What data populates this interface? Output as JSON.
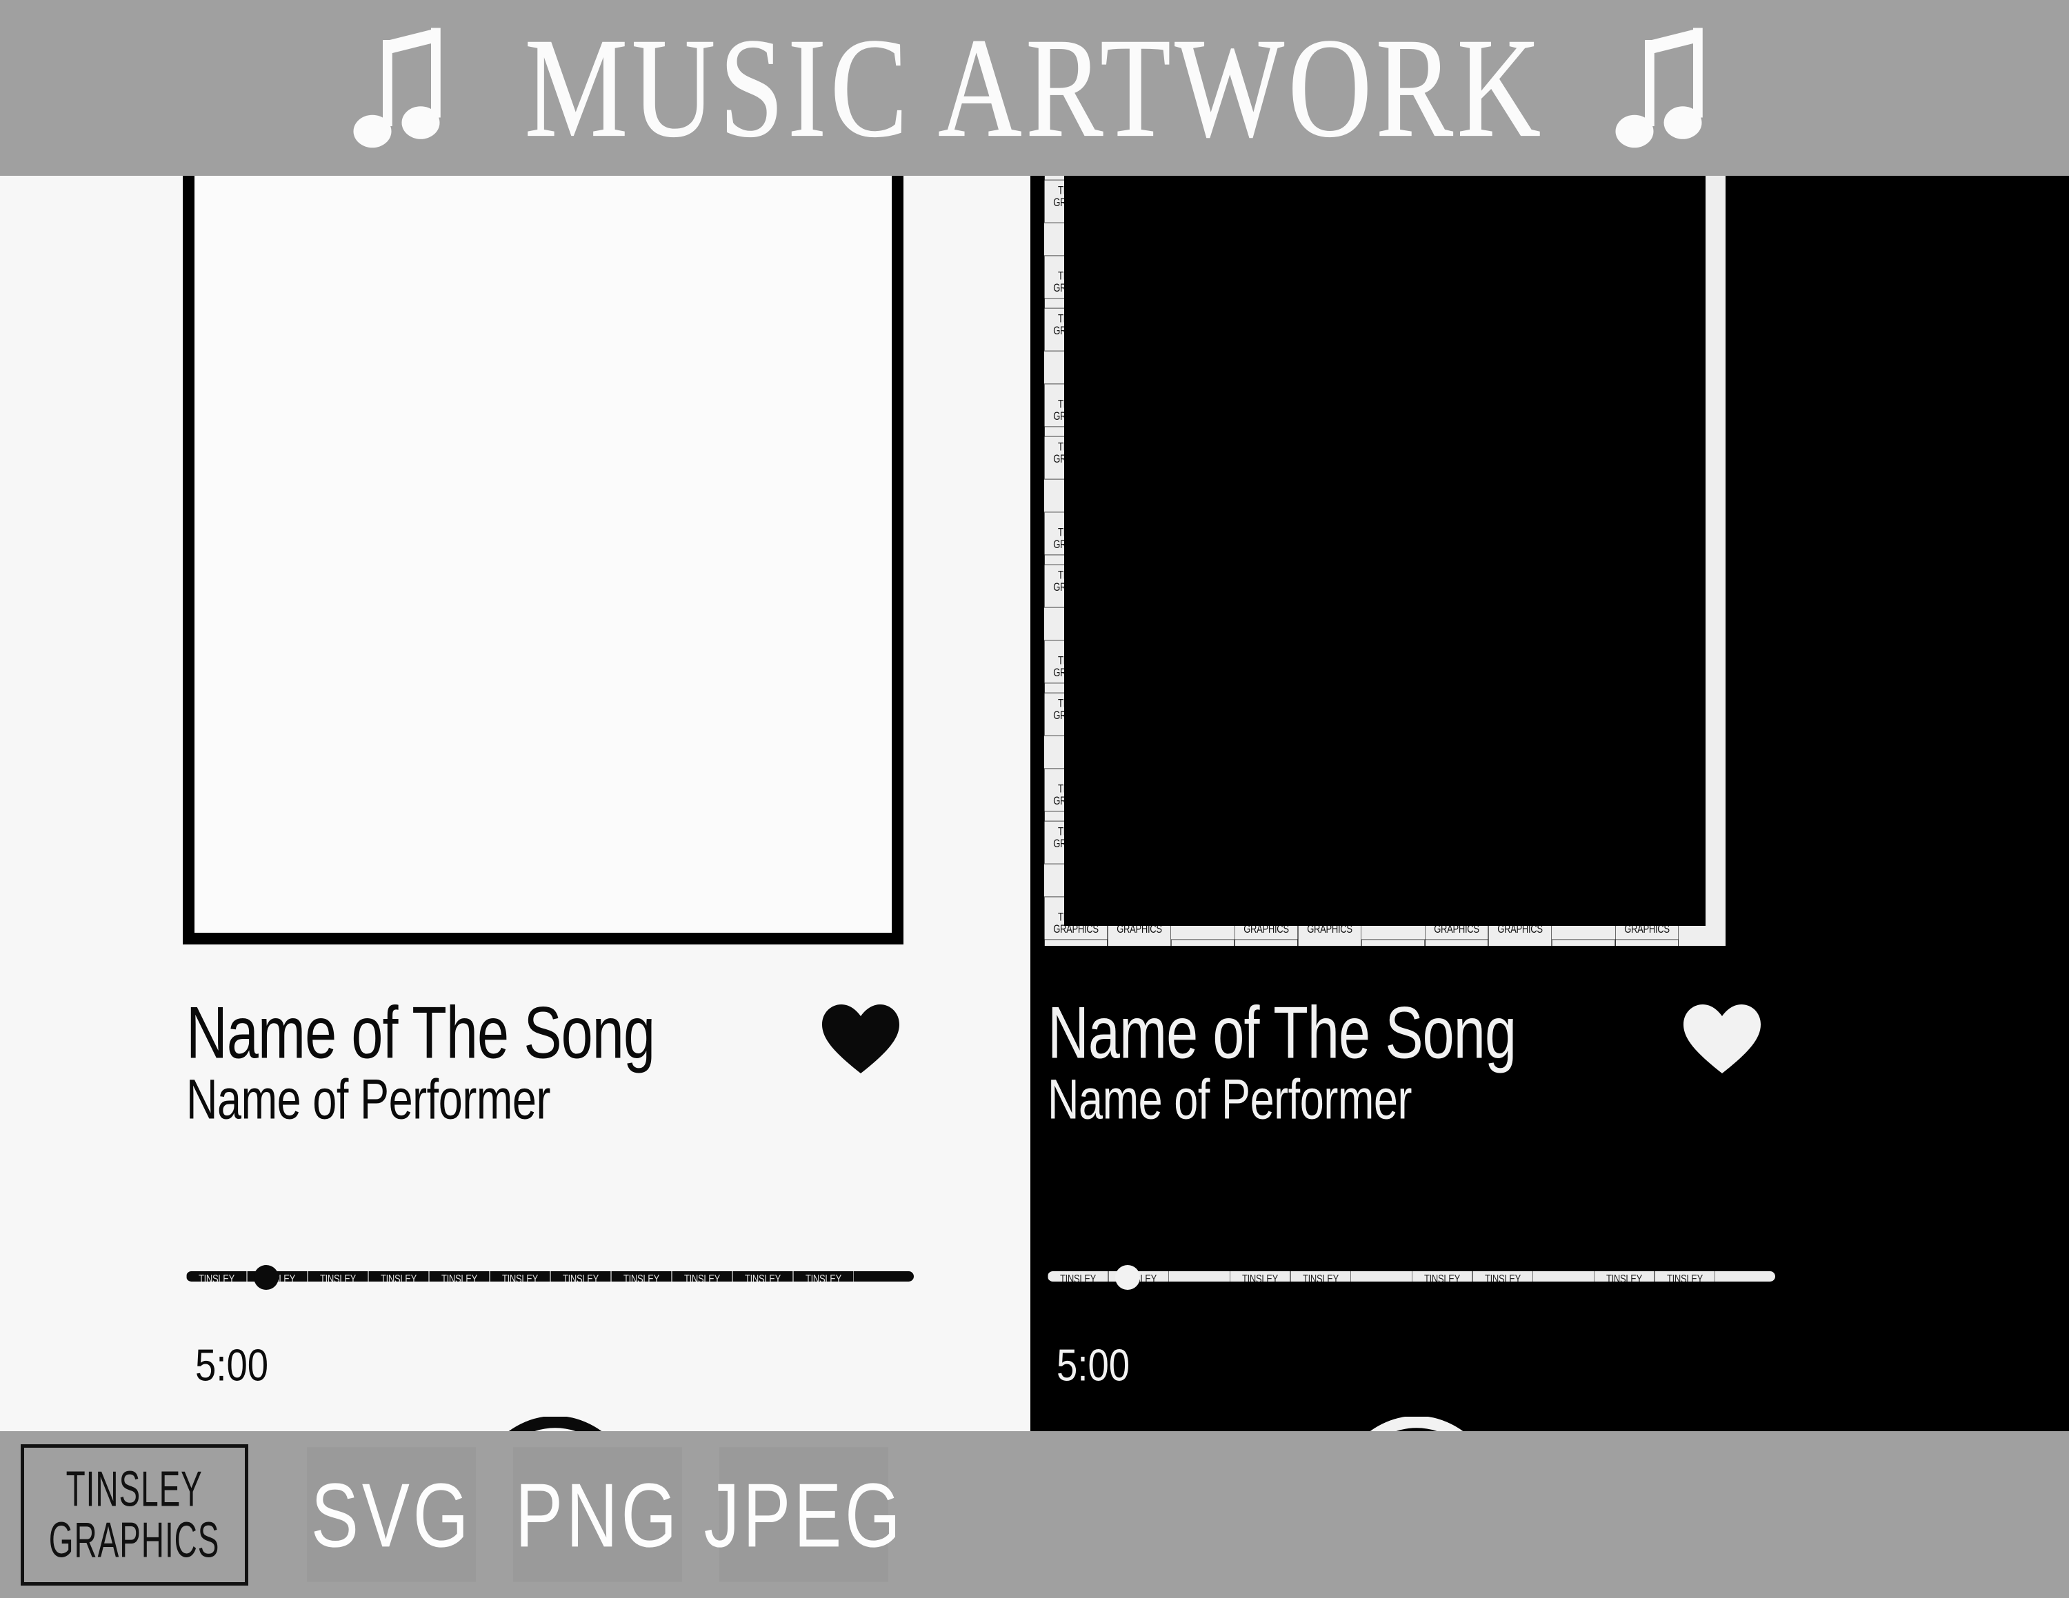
{
  "header": {
    "title": "MUSIC ARTWORK",
    "left_icon": "music-note-icon",
    "right_icon": "music-note-icon",
    "bg_color": "#a0a0a0",
    "text_color": "#fbfbfb"
  },
  "watermark": {
    "line1": "TINSLEY",
    "line2": "GRAPHICS"
  },
  "panels": [
    {
      "variant": "light",
      "bg_color": "#f7f7f7",
      "fg_color": "#0a0a0a",
      "artwork": {
        "label": "album-artwork-placeholder",
        "frame_color": "#000000",
        "fill_color": "#fbfbfb"
      },
      "song_title": "Name of The Song",
      "performer": "Name of Performer",
      "duration": "5:00",
      "progress_percent": 11,
      "like_icon": "heart-icon",
      "controls": [
        {
          "name": "shuffle-button",
          "icon": "shuffle-icon"
        },
        {
          "name": "previous-button",
          "icon": "skip-previous-icon"
        },
        {
          "name": "play-button",
          "icon": "play-icon"
        },
        {
          "name": "next-button",
          "icon": "skip-next-icon"
        },
        {
          "name": "repeat-button",
          "icon": "repeat-icon"
        }
      ]
    },
    {
      "variant": "dark",
      "bg_color": "#000000",
      "fg_color": "#f2f2f2",
      "artwork": {
        "label": "album-artwork-placeholder",
        "frame_color": "#eeeeee",
        "fill_color": "#000000"
      },
      "song_title": "Name of The Song",
      "performer": "Name of Performer",
      "duration": "5:00",
      "progress_percent": 11,
      "like_icon": "heart-icon",
      "controls": [
        {
          "name": "shuffle-button",
          "icon": "shuffle-icon"
        },
        {
          "name": "previous-button",
          "icon": "skip-previous-icon"
        },
        {
          "name": "play-button",
          "icon": "play-icon"
        },
        {
          "name": "next-button",
          "icon": "skip-next-icon"
        },
        {
          "name": "repeat-button",
          "icon": "repeat-icon"
        }
      ]
    }
  ],
  "footer": {
    "bg_color": "#a0a0a0",
    "logo_line1": "TINSLEY",
    "logo_line2": "GRAPHICS",
    "formats": [
      "SVG",
      "PNG",
      "JPEG"
    ],
    "format_bg": "#9a9a9a",
    "format_text_color": "#fdfdfd"
  }
}
